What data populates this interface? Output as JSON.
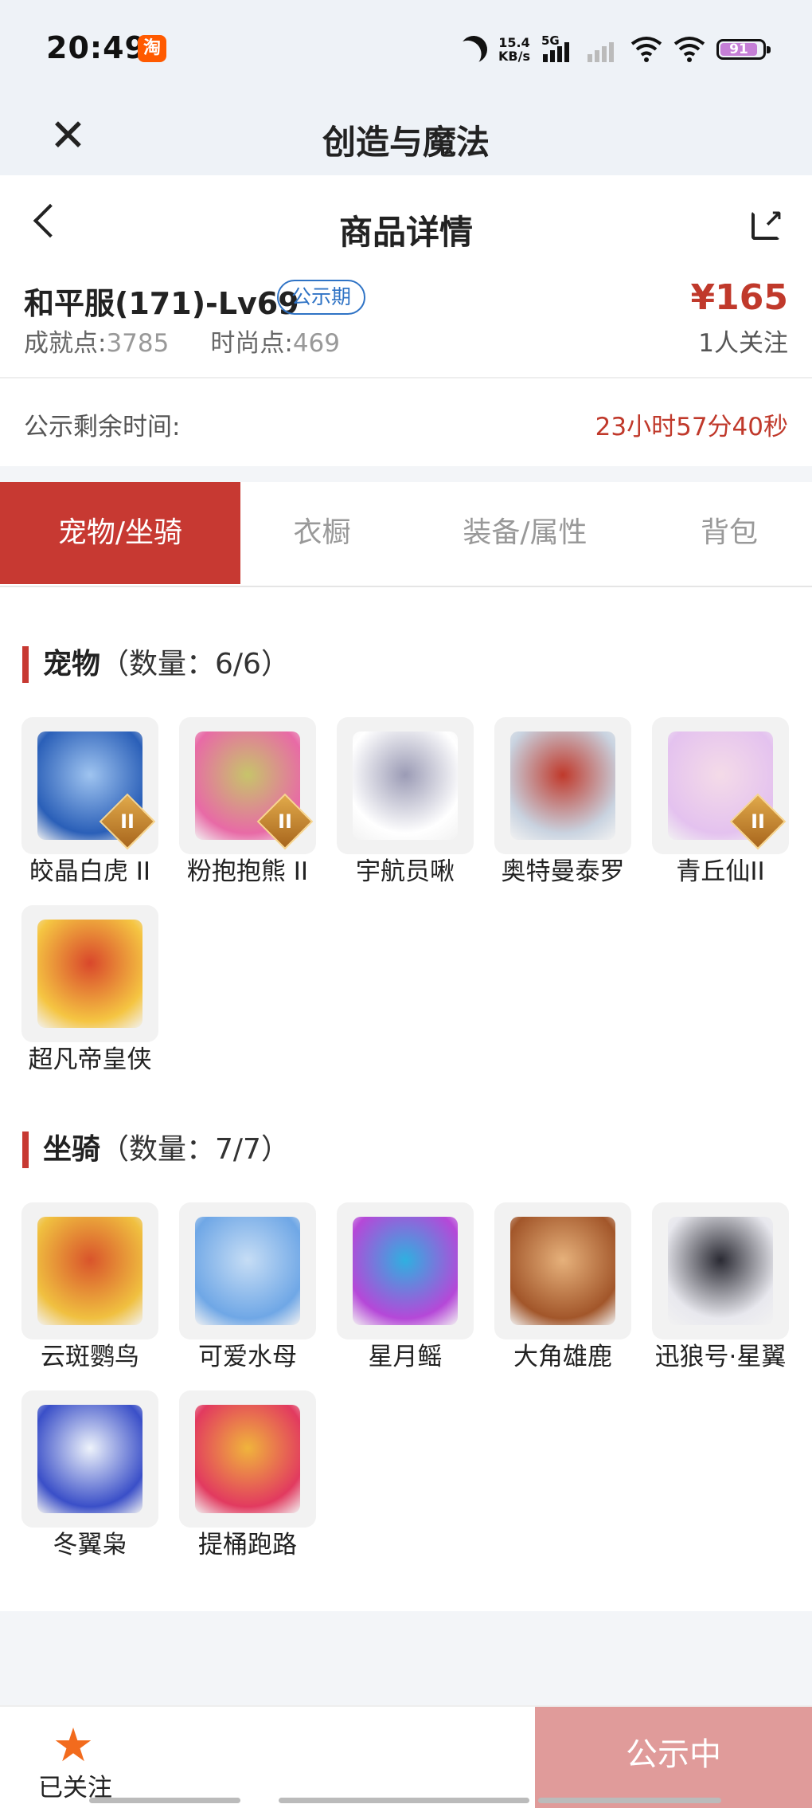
{
  "status_bar": {
    "time": "20:49",
    "taobao_glyph": "淘",
    "net_speed_top": "15.4",
    "net_speed_bottom": "KB/s",
    "network_type": "5G",
    "battery": "91"
  },
  "app_bar": {
    "title": "创造与魔法",
    "close_glyph": "✕"
  },
  "detail": {
    "header_title": "商品详情",
    "product_name": "和平服(171)-Lv69",
    "badge": "公示期",
    "price": "¥165",
    "achievement_label": "成就点:",
    "achievement_value": "3785",
    "fashion_label": "时尚点:",
    "fashion_value": "469",
    "watchers": "1人关注",
    "remaining_label": "公示剩余时间:",
    "remaining_value": "23小时57分40秒"
  },
  "tabs": [
    {
      "label": "宠物/坐骑",
      "active": true
    },
    {
      "label": "衣橱",
      "active": false
    },
    {
      "label": "装备/属性",
      "active": false
    },
    {
      "label": "背包",
      "active": false
    }
  ],
  "pets": {
    "title": "宠物",
    "count": "（数量：6/6）",
    "items": [
      {
        "name": "皎晶白虎 II",
        "level": "II",
        "colors": [
          "#2a5fb8",
          "#9fc4f0"
        ]
      },
      {
        "name": "粉抱抱熊 II",
        "level": "II",
        "colors": [
          "#e86aa6",
          "#c7c46a"
        ]
      },
      {
        "name": "宇航员啾",
        "level": "",
        "colors": [
          "#ffffff",
          "#9b9bb5"
        ]
      },
      {
        "name": "奥特曼泰罗",
        "level": "",
        "colors": [
          "#c9d3e0",
          "#c0392b"
        ]
      },
      {
        "name": "青丘仙II",
        "level": "II",
        "colors": [
          "#e4c2ef",
          "#f4dbe8"
        ]
      },
      {
        "name": "超凡帝皇侠",
        "level": "",
        "colors": [
          "#f5c542",
          "#d9472b"
        ]
      }
    ]
  },
  "mounts": {
    "title": "坐骑",
    "count": "（数量：7/7）",
    "items": [
      {
        "name": "云斑鹦鸟",
        "colors": [
          "#f0c040",
          "#d9542b"
        ]
      },
      {
        "name": "可爱水母",
        "colors": [
          "#6fa7e6",
          "#c6ddf5"
        ]
      },
      {
        "name": "星月鳐",
        "colors": [
          "#b548d8",
          "#2fb0e0"
        ]
      },
      {
        "name": "大角雄鹿",
        "colors": [
          "#a2562a",
          "#e6b17b"
        ]
      },
      {
        "name": "迅狼号·星翼",
        "colors": [
          "#e8e8ee",
          "#2a2a33"
        ]
      },
      {
        "name": "冬翼枭",
        "colors": [
          "#3a4fc8",
          "#eef3fb"
        ]
      },
      {
        "name": "提桶跑路",
        "colors": [
          "#e23a5f",
          "#f0b43c"
        ]
      }
    ]
  },
  "bottom_bar": {
    "follow_label": "已关注",
    "action_label": "公示中"
  }
}
